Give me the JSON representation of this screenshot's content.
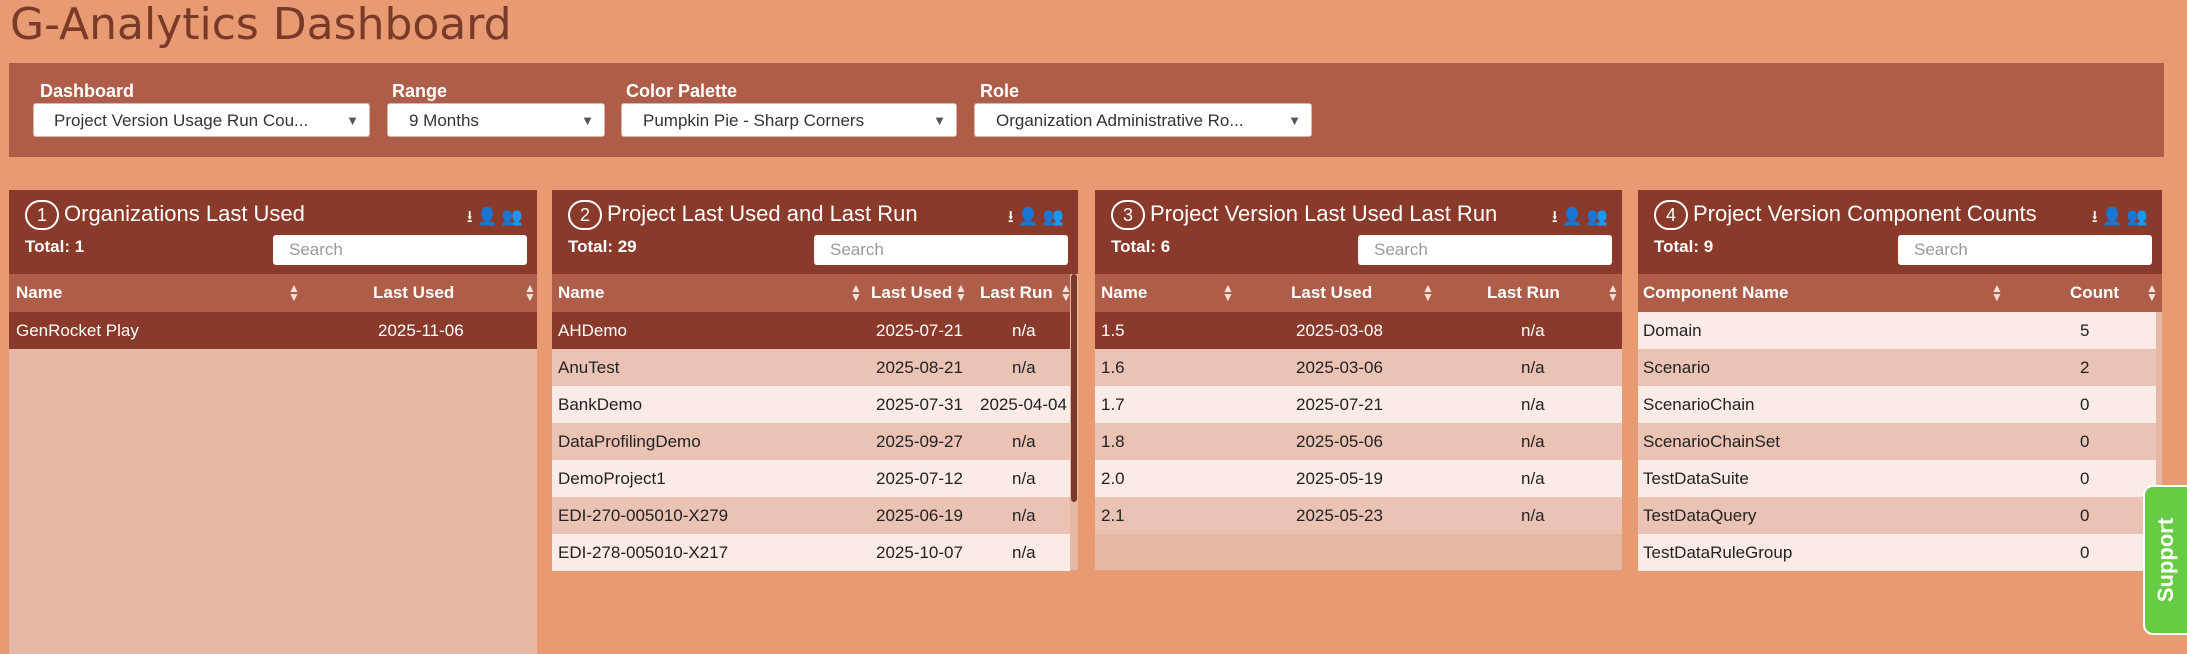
{
  "app": {
    "title": "G-Analytics Dashboard"
  },
  "filters": [
    {
      "label": "Dashboard",
      "value": "Project Version Usage Run Cou..."
    },
    {
      "label": "Range",
      "value": "9 Months"
    },
    {
      "label": "Color Palette",
      "value": "Pumpkin Pie - Sharp Corners"
    },
    {
      "label": "Role",
      "value": "Organization Administrative Ro..."
    }
  ],
  "panels": [
    {
      "number": "1",
      "title": "Organizations Last Used",
      "total": "Total: 1",
      "search_placeholder": "Search",
      "columns": [
        "Name",
        "Last Used"
      ],
      "rows": [
        [
          "GenRocket Play",
          "2025-11-06"
        ]
      ]
    },
    {
      "number": "2",
      "title": "Project Last Used and Last Run",
      "total": "Total: 29",
      "search_placeholder": "Search",
      "columns": [
        "Name",
        "Last Used",
        "Last Run"
      ],
      "rows": [
        [
          "AHDemo",
          "2025-07-21",
          "n/a"
        ],
        [
          "AnuTest",
          "2025-08-21",
          "n/a"
        ],
        [
          "BankDemo",
          "2025-07-31",
          "2025-04-04"
        ],
        [
          "DataProfilingDemo",
          "2025-09-27",
          "n/a"
        ],
        [
          "DemoProject1",
          "2025-07-12",
          "n/a"
        ],
        [
          "EDI-270-005010-X279",
          "2025-06-19",
          "n/a"
        ],
        [
          "EDI-278-005010-X217",
          "2025-10-07",
          "n/a"
        ]
      ]
    },
    {
      "number": "3",
      "title": "Project Version Last Used Last Run",
      "total": "Total: 6",
      "search_placeholder": "Search",
      "columns": [
        "Name",
        "Last Used",
        "Last Run"
      ],
      "rows": [
        [
          "1.5",
          "2025-03-08",
          "n/a"
        ],
        [
          "1.6",
          "2025-03-06",
          "n/a"
        ],
        [
          "1.7",
          "2025-07-21",
          "n/a"
        ],
        [
          "1.8",
          "2025-05-06",
          "n/a"
        ],
        [
          "2.0",
          "2025-05-19",
          "n/a"
        ],
        [
          "2.1",
          "2025-05-23",
          "n/a"
        ]
      ]
    },
    {
      "number": "4",
      "title": "Project Version Component Counts",
      "total": "Total: 9",
      "search_placeholder": "Search",
      "columns": [
        "Component Name",
        "Count"
      ],
      "rows": [
        [
          "Domain",
          "5"
        ],
        [
          "Scenario",
          "2"
        ],
        [
          "ScenarioChain",
          "0"
        ],
        [
          "ScenarioChainSet",
          "0"
        ],
        [
          "TestDataSuite",
          "0"
        ],
        [
          "TestDataQuery",
          "0"
        ],
        [
          "TestDataRuleGroup",
          "0"
        ]
      ]
    }
  ],
  "support": {
    "label": "Support"
  },
  "colors": {
    "background": "#e89a72",
    "header": "#8a3a2a",
    "filter_bar": "#ae5e48",
    "support": "#66cc44"
  }
}
